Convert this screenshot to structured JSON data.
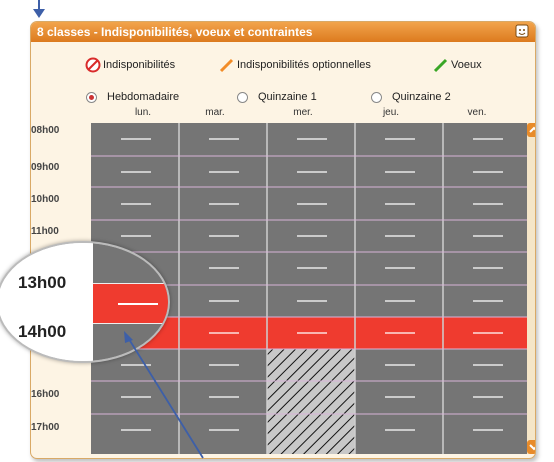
{
  "panel": {
    "title": "8 classes - Indisponibilités, voeux et contraintes"
  },
  "legend": [
    {
      "label": "Indisponibilités",
      "icon": "forbidden-brush-icon",
      "color": "#d92b2b"
    },
    {
      "label": "Indisponibilités optionnelles",
      "icon": "orange-brush-icon",
      "color": "#f28c28"
    },
    {
      "label": "Voeux",
      "icon": "green-brush-icon",
      "color": "#3aa626"
    }
  ],
  "periods": [
    {
      "label": "Hebdomadaire",
      "selected": true
    },
    {
      "label": "Quinzaine 1",
      "selected": false
    },
    {
      "label": "Quinzaine 2",
      "selected": false
    }
  ],
  "days": [
    "lun.",
    "mar.",
    "mer.",
    "jeu.",
    "ven."
  ],
  "hours": [
    "08h00",
    "09h00",
    "10h00",
    "11h00",
    "16h00",
    "17h00"
  ],
  "magnifier": {
    "top": "13h00",
    "bottom": "14h00"
  },
  "colors": {
    "cell": "#757575",
    "unavailable": "#ef3b2f",
    "accent": "#e88b2a"
  }
}
